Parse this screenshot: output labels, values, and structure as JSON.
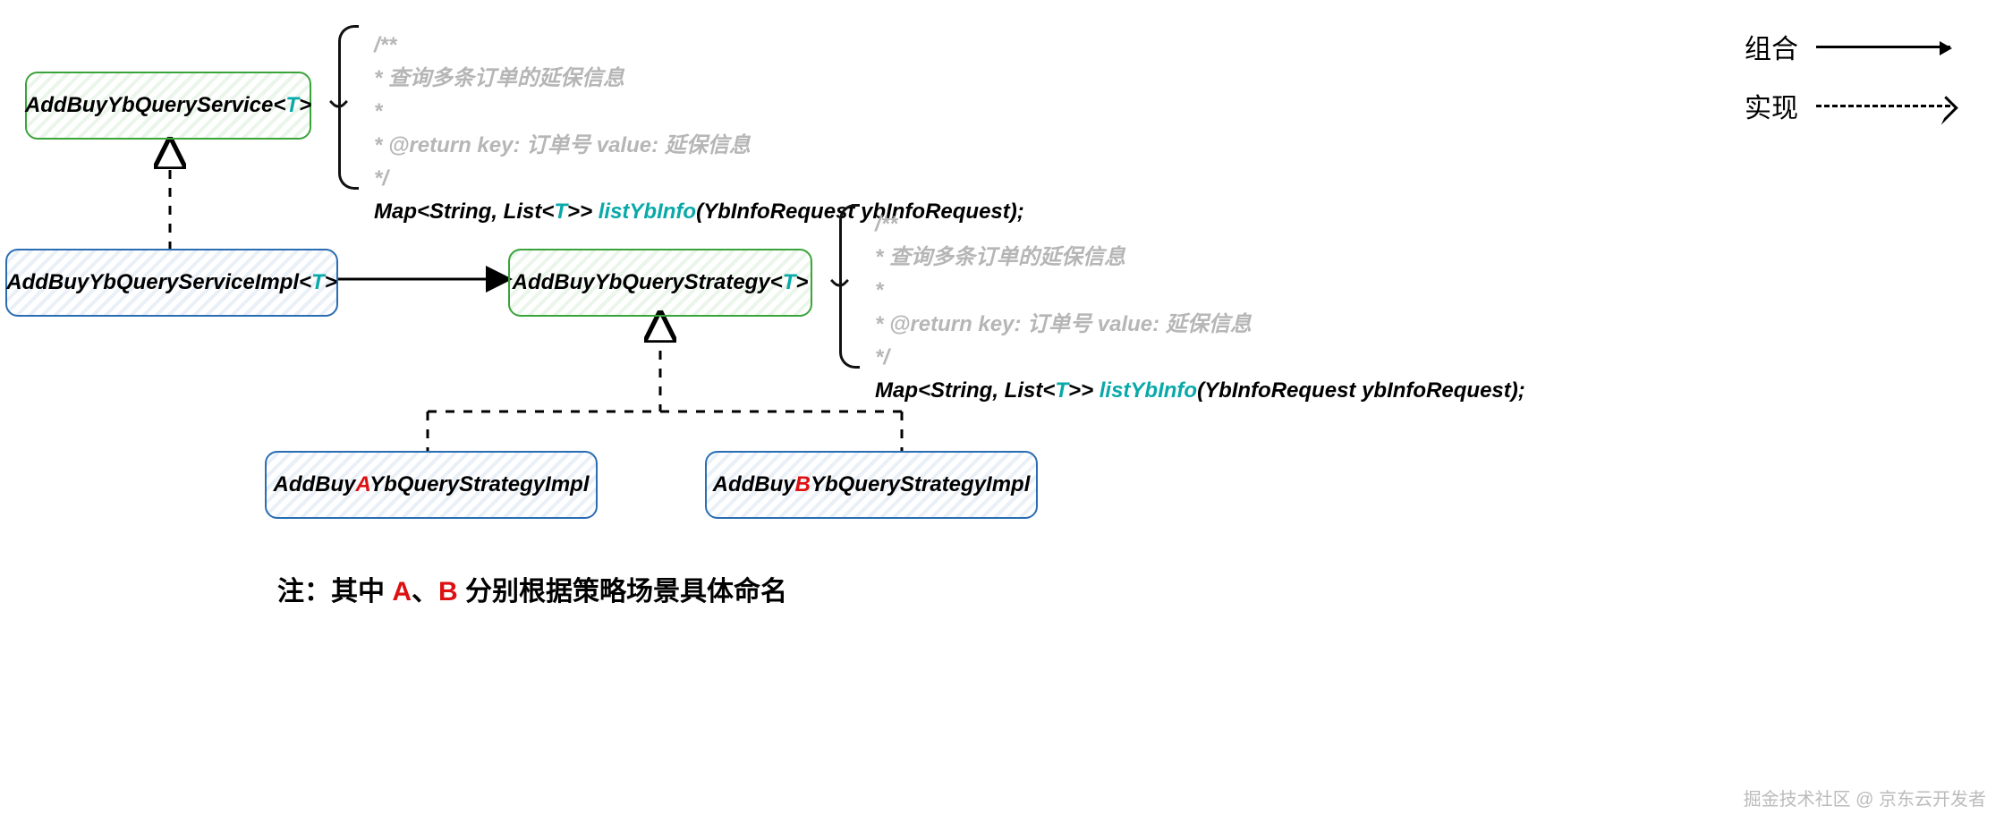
{
  "boxes": {
    "service_if": {
      "prefix": "AddBuyYbQueryService<",
      "t": "T",
      "suffix": ">"
    },
    "service_impl": {
      "prefix": "AddBuyYbQueryServiceImpl<",
      "t": "T",
      "suffix": ">"
    },
    "strategy_if": {
      "prefix": "AddBuyYbQueryStrategy<",
      "t": "T",
      "suffix": ">"
    },
    "strategy_a": {
      "prefix": "AddBuy",
      "hl": "A",
      "suffix": "YbQueryStrategyImpl"
    },
    "strategy_b": {
      "prefix": "AddBuy",
      "hl": "B",
      "suffix": "YbQueryStrategyImpl"
    }
  },
  "code": {
    "l1": "/**",
    "l2": "* 查询多条订单的延保信息",
    "l3": "*",
    "l4": "* @return key: 订单号 value: 延保信息",
    "l5": "*/",
    "sig_pre": "Map<String, List<",
    "sig_t": "T",
    "sig_mid": ">> ",
    "sig_fn": "listYbInfo",
    "sig_post": "(YbInfoRequest ybInfoRequest);"
  },
  "legend": {
    "compose": "组合",
    "implement": "实现"
  },
  "note": {
    "pre": "注：其中 ",
    "a": "A",
    "sep": "、",
    "b": "B",
    "post": " 分别根据策略场景具体命名"
  },
  "watermark": "掘金技术社区 @ 京东云开发者"
}
